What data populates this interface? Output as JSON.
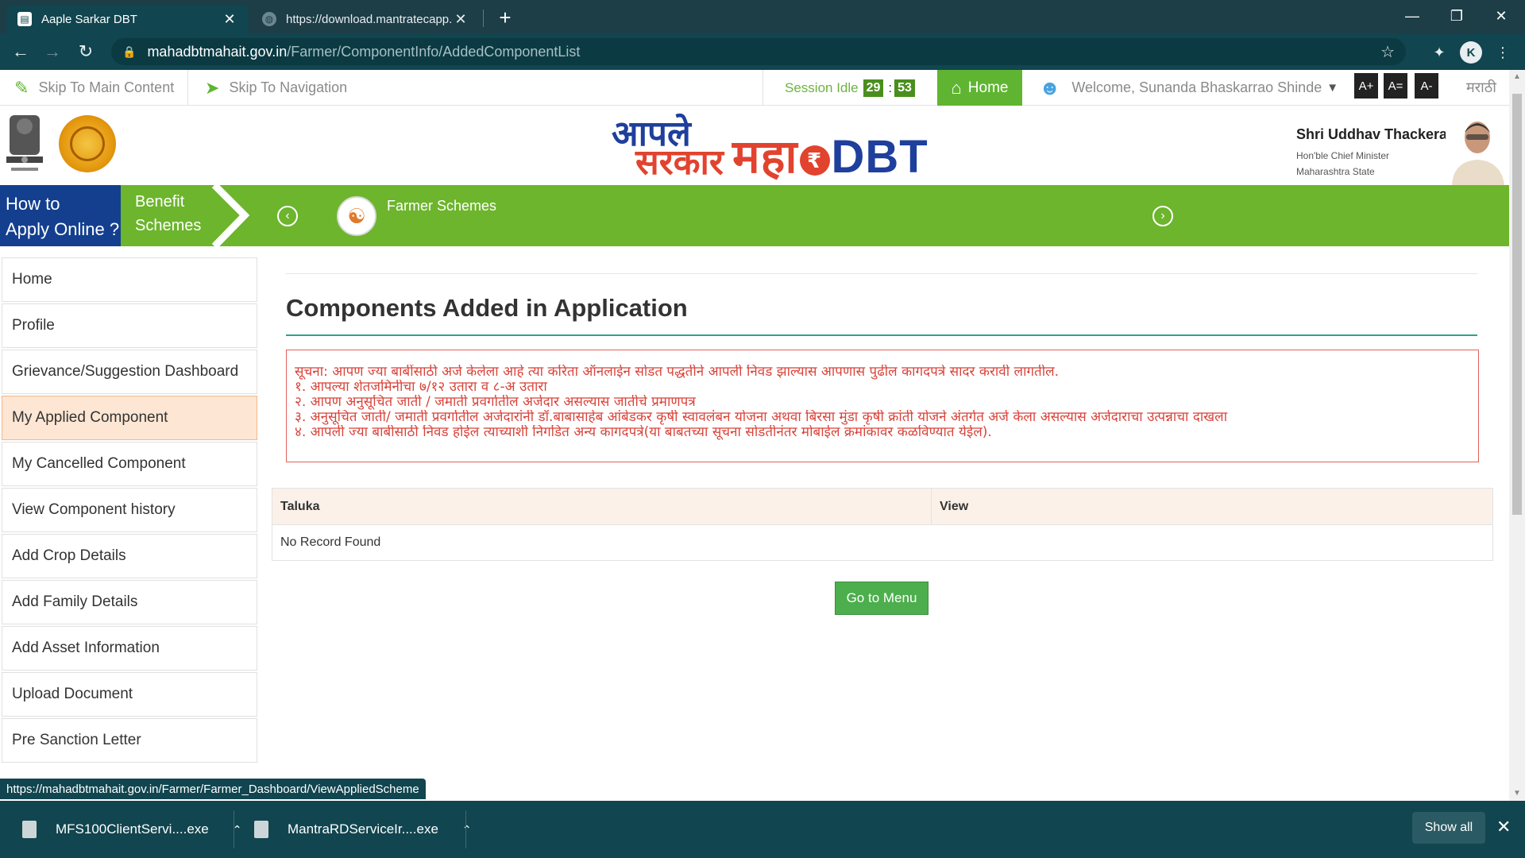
{
  "browser": {
    "tabs": [
      {
        "title": "Aaple Sarkar DBT",
        "close": "✕"
      },
      {
        "title": "https://download.mantratecapp.c",
        "close": "✕"
      }
    ],
    "new_tab": "+",
    "url_host": "mahadbtmahait.gov.in",
    "url_path": "/Farmer/ComponentInfo/AddedComponentList",
    "status_url": "https://mahadbtmahait.gov.in/Farmer/Farmer_Dashboard/ViewAppliedScheme"
  },
  "topbar": {
    "skip_main": "Skip To Main Content",
    "skip_nav": "Skip To Navigation",
    "session_label": "Session Idle",
    "session_min": "29",
    "session_sec": "53",
    "session_sep": ":",
    "home": "Home",
    "welcome": "Welcome, Sunanda Bhaskarrao Shinde",
    "font_plus": "A+",
    "font_eq": "A=",
    "font_minus": "A-",
    "lang": "मराठी"
  },
  "header": {
    "logo_aaple_1": "आपले",
    "logo_aaple_2": "सरकार",
    "logo_maha": "महा",
    "logo_rupee": "₹",
    "logo_dbt": "DBT",
    "cm_name": "Shri Uddhav Thackeray",
    "cm_title": "Hon'ble Chief Minister",
    "cm_state": "Maharashtra State"
  },
  "greenbar": {
    "howto_1": "How to",
    "howto_2": "Apply Online ?",
    "benefit_1": "Benefit",
    "benefit_2": "Schemes",
    "farmer": "Farmer Schemes"
  },
  "sidebar": {
    "items": [
      {
        "label": "Home"
      },
      {
        "label": "Profile"
      },
      {
        "label": "Grievance/Suggestion Dashboard"
      },
      {
        "label": "My Applied Component"
      },
      {
        "label": "My Cancelled Component"
      },
      {
        "label": "View Component history"
      },
      {
        "label": "Add Crop Details"
      },
      {
        "label": "Add Family Details"
      },
      {
        "label": "Add Asset Information"
      },
      {
        "label": "Upload Document"
      },
      {
        "label": "Pre Sanction Letter"
      }
    ],
    "active_index": 3
  },
  "main": {
    "title": "Components Added in Application",
    "notice": [
      "सूचना: आपण ज्या बाबींसाठी अर्ज केलेला आहे त्या करिता ऑनलाईन सोडत पद्धतीने आपली निवड झाल्यास आपणास पुढील कागदपत्रे सादर करावी लागतील.",
      "१. आपल्या शेतजमिनीचा ७/१२ उतारा व ८-अ उतारा",
      "२. आपण अनुसूचित जाती / जमाती प्रवर्गातील अर्जदार असल्यास जातीचे प्रमाणपत्र",
      "३. अनुसूचित जाती/ जमाती प्रवर्गातील अर्जदारांनी डॉ.बाबासाहेब आंबेडकर कृषी स्वावलंबन योजना अथवा बिरसा मुंडा कृषी क्रांती योजने अंतर्गत अर्ज केला असल्यास अर्जदाराचा उत्पन्नाचा दाखला",
      "४. आपली ज्या बाबीसाठी निवड होईल त्याच्याशी निगडित अन्य कागदपत्रे(या बाबतच्या सूचना सोडतीनंतर मोबाईल क्रमांकावर कळविण्यात येईल)."
    ],
    "table": {
      "columns": [
        "Taluka",
        "View"
      ],
      "empty": "No Record Found"
    },
    "goto_menu": "Go to Menu"
  },
  "downloads": {
    "items": [
      {
        "name": "MFS100ClientServi....exe"
      },
      {
        "name": "MantraRDServiceIr....exe"
      }
    ],
    "show_all": "Show all"
  },
  "colors": {
    "chrome": "#11454f",
    "green": "#6cb52c",
    "blue": "#143f8f",
    "active_item": "#fde6d3",
    "notice_red": "#d9433a"
  }
}
